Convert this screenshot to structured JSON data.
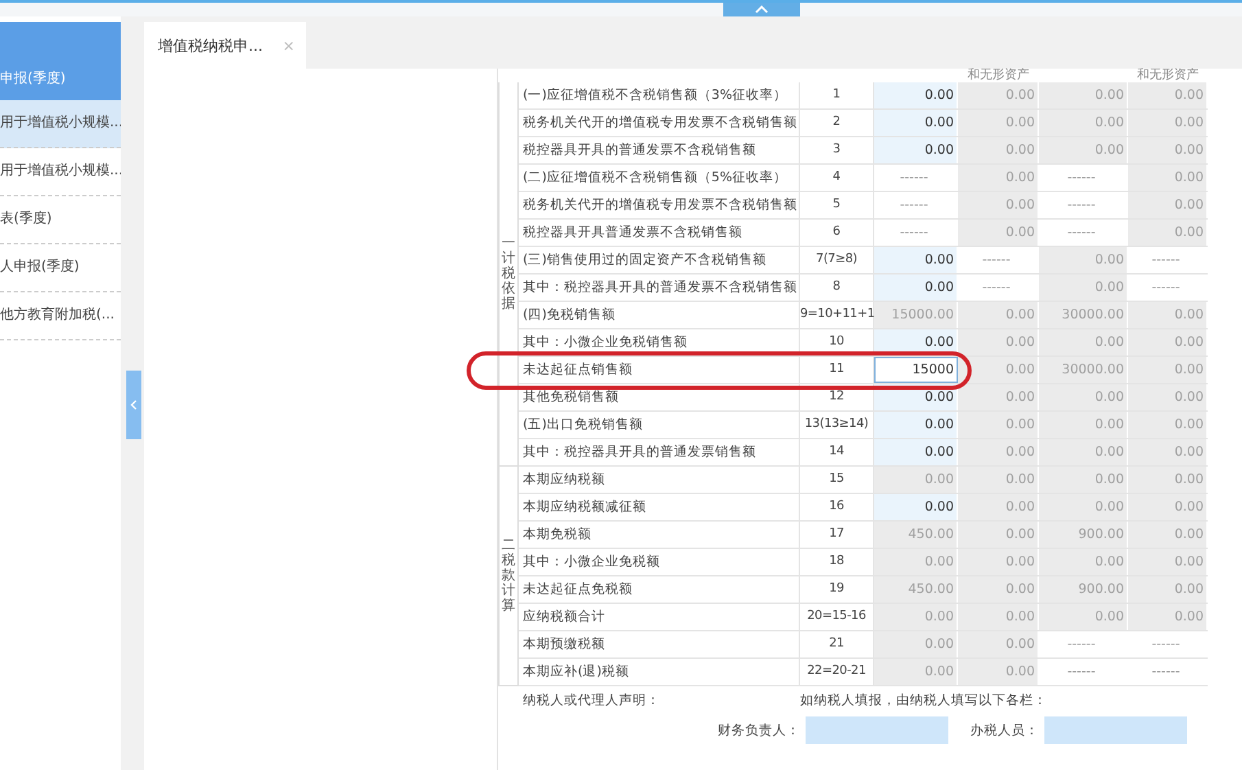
{
  "sidebar": {
    "items": [
      {
        "label": "申报(季度)",
        "kind": "header"
      },
      {
        "label": "用于增值税小规模...",
        "kind": "item",
        "selected": true
      },
      {
        "label": "用于增值税小规模...",
        "kind": "item",
        "selected": false
      },
      {
        "label": "表(季度)",
        "kind": "item",
        "selected": false
      },
      {
        "label": "人申报(季度)",
        "kind": "item",
        "selected": false
      },
      {
        "label": "他方教育附加税(...",
        "kind": "item",
        "selected": false
      }
    ]
  },
  "tabs": [
    {
      "label": "增值税纳税申...",
      "close": "×",
      "selected": true
    }
  ],
  "table": {
    "column_headers": {
      "column_2": "和无形资产",
      "column_4": "和无形资产"
    },
    "sections": [
      {
        "label": "一计税依据",
        "rows": [
          {
            "label": "(一)应征增值税不含税销售额（3%征收率）",
            "line": "1",
            "highlighted": false,
            "cells": [
              {
                "value": "0.00",
                "kind": "input"
              },
              {
                "value": "0.00",
                "kind": "calc"
              },
              {
                "value": "0.00",
                "kind": "calc"
              },
              {
                "value": "0.00",
                "kind": "calc"
              }
            ]
          },
          {
            "label": "税务机关代开的增值税专用发票不含税销售额",
            "line": "2",
            "highlighted": false,
            "cells": [
              {
                "value": "0.00",
                "kind": "input"
              },
              {
                "value": "0.00",
                "kind": "calc"
              },
              {
                "value": "0.00",
                "kind": "calc"
              },
              {
                "value": "0.00",
                "kind": "calc"
              }
            ]
          },
          {
            "label": "税控器具开具的普通发票不含税销售额",
            "line": "3",
            "highlighted": false,
            "cells": [
              {
                "value": "0.00",
                "kind": "input"
              },
              {
                "value": "0.00",
                "kind": "calc"
              },
              {
                "value": "0.00",
                "kind": "calc"
              },
              {
                "value": "0.00",
                "kind": "calc"
              }
            ]
          },
          {
            "label": "(二)应征增值税不含税销售额（5%征收率）",
            "line": "4",
            "highlighted": false,
            "cells": [
              {
                "value": "------",
                "kind": "blank"
              },
              {
                "value": "0.00",
                "kind": "calc"
              },
              {
                "value": "------",
                "kind": "blank"
              },
              {
                "value": "0.00",
                "kind": "calc"
              }
            ]
          },
          {
            "label": "税务机关代开的增值税专用发票不含税销售额",
            "line": "5",
            "highlighted": false,
            "cells": [
              {
                "value": "------",
                "kind": "blank"
              },
              {
                "value": "0.00",
                "kind": "calc"
              },
              {
                "value": "------",
                "kind": "blank"
              },
              {
                "value": "0.00",
                "kind": "calc"
              }
            ]
          },
          {
            "label": "税控器具开具普通发票不含税销售额",
            "line": "6",
            "highlighted": false,
            "cells": [
              {
                "value": "------",
                "kind": "blank"
              },
              {
                "value": "0.00",
                "kind": "calc"
              },
              {
                "value": "------",
                "kind": "blank"
              },
              {
                "value": "0.00",
                "kind": "calc"
              }
            ]
          },
          {
            "label": "(三)销售使用过的固定资产不含税销售额",
            "line": "7(7≥8)",
            "highlighted": false,
            "cells": [
              {
                "value": "0.00",
                "kind": "input"
              },
              {
                "value": "------",
                "kind": "blank"
              },
              {
                "value": "0.00",
                "kind": "calc"
              },
              {
                "value": "------",
                "kind": "blank"
              }
            ]
          },
          {
            "label": "其中：税控器具开具的普通发票不含税销售额",
            "line": "8",
            "highlighted": false,
            "cells": [
              {
                "value": "0.00",
                "kind": "input"
              },
              {
                "value": "------",
                "kind": "blank"
              },
              {
                "value": "0.00",
                "kind": "calc"
              },
              {
                "value": "------",
                "kind": "blank"
              }
            ]
          },
          {
            "label": "(四)免税销售额",
            "line": "9=10+11+1",
            "highlighted": false,
            "cells": [
              {
                "value": "15000.00",
                "kind": "calc"
              },
              {
                "value": "0.00",
                "kind": "calc"
              },
              {
                "value": "30000.00",
                "kind": "calc"
              },
              {
                "value": "0.00",
                "kind": "calc"
              }
            ]
          },
          {
            "label": "其中：小微企业免税销售额",
            "line": "10",
            "highlighted": false,
            "cells": [
              {
                "value": "0.00",
                "kind": "input"
              },
              {
                "value": "0.00",
                "kind": "calc"
              },
              {
                "value": "0.00",
                "kind": "calc"
              },
              {
                "value": "0.00",
                "kind": "calc"
              }
            ]
          },
          {
            "label": "未达起征点销售额",
            "line": "11",
            "highlighted": true,
            "cells": [
              {
                "value": "15000",
                "kind": "active"
              },
              {
                "value": "0.00",
                "kind": "calc"
              },
              {
                "value": "30000.00",
                "kind": "calc"
              },
              {
                "value": "0.00",
                "kind": "calc"
              }
            ]
          },
          {
            "label": "其他免税销售额",
            "line": "12",
            "highlighted": false,
            "cells": [
              {
                "value": "0.00",
                "kind": "input"
              },
              {
                "value": "0.00",
                "kind": "calc"
              },
              {
                "value": "0.00",
                "kind": "calc"
              },
              {
                "value": "0.00",
                "kind": "calc"
              }
            ]
          },
          {
            "label": "(五)出口免税销售额",
            "line": "13(13≥14)",
            "highlighted": false,
            "cells": [
              {
                "value": "0.00",
                "kind": "input"
              },
              {
                "value": "0.00",
                "kind": "calc"
              },
              {
                "value": "0.00",
                "kind": "calc"
              },
              {
                "value": "0.00",
                "kind": "calc"
              }
            ]
          },
          {
            "label": "其中：税控器具开具的普通发票销售额",
            "line": "14",
            "highlighted": false,
            "cells": [
              {
                "value": "0.00",
                "kind": "input"
              },
              {
                "value": "0.00",
                "kind": "calc"
              },
              {
                "value": "0.00",
                "kind": "calc"
              },
              {
                "value": "0.00",
                "kind": "calc"
              }
            ]
          }
        ]
      },
      {
        "label": "二税款计算",
        "rows": [
          {
            "label": "本期应纳税额",
            "line": "15",
            "highlighted": false,
            "cells": [
              {
                "value": "0.00",
                "kind": "calc"
              },
              {
                "value": "0.00",
                "kind": "calc"
              },
              {
                "value": "0.00",
                "kind": "calc"
              },
              {
                "value": "0.00",
                "kind": "calc"
              }
            ]
          },
          {
            "label": "本期应纳税额减征额",
            "line": "16",
            "highlighted": false,
            "cells": [
              {
                "value": "0.00",
                "kind": "input"
              },
              {
                "value": "0.00",
                "kind": "calc"
              },
              {
                "value": "0.00",
                "kind": "calc"
              },
              {
                "value": "0.00",
                "kind": "calc"
              }
            ]
          },
          {
            "label": "本期免税额",
            "line": "17",
            "highlighted": false,
            "cells": [
              {
                "value": "450.00",
                "kind": "calc"
              },
              {
                "value": "0.00",
                "kind": "calc"
              },
              {
                "value": "900.00",
                "kind": "calc"
              },
              {
                "value": "0.00",
                "kind": "calc"
              }
            ]
          },
          {
            "label": "其中：小微企业免税额",
            "line": "18",
            "highlighted": false,
            "cells": [
              {
                "value": "0.00",
                "kind": "calc"
              },
              {
                "value": "0.00",
                "kind": "calc"
              },
              {
                "value": "0.00",
                "kind": "calc"
              },
              {
                "value": "0.00",
                "kind": "calc"
              }
            ]
          },
          {
            "label": "未达起征点免税额",
            "line": "19",
            "highlighted": false,
            "cells": [
              {
                "value": "450.00",
                "kind": "calc"
              },
              {
                "value": "0.00",
                "kind": "calc"
              },
              {
                "value": "900.00",
                "kind": "calc"
              },
              {
                "value": "0.00",
                "kind": "calc"
              }
            ]
          },
          {
            "label": "应纳税额合计",
            "line": "20=15-16",
            "highlighted": false,
            "cells": [
              {
                "value": "0.00",
                "kind": "calc"
              },
              {
                "value": "0.00",
                "kind": "calc"
              },
              {
                "value": "0.00",
                "kind": "calc"
              },
              {
                "value": "0.00",
                "kind": "calc"
              }
            ]
          },
          {
            "label": "本期预缴税额",
            "line": "21",
            "highlighted": false,
            "cells": [
              {
                "value": "0.00",
                "kind": "calc"
              },
              {
                "value": "0.00",
                "kind": "calc"
              },
              {
                "value": "------",
                "kind": "blank"
              },
              {
                "value": "------",
                "kind": "blank"
              }
            ]
          },
          {
            "label": "本期应补(退)税额",
            "line": "22=20-21",
            "highlighted": false,
            "cells": [
              {
                "value": "0.00",
                "kind": "calc"
              },
              {
                "value": "0.00",
                "kind": "calc"
              },
              {
                "value": "------",
                "kind": "blank"
              },
              {
                "value": "------",
                "kind": "blank"
              }
            ]
          }
        ]
      }
    ]
  },
  "declaration": {
    "label": "纳税人或代理人声明：",
    "note": "如纳税人填报，由纳税人填写以下各栏：",
    "fields": [
      {
        "label": "财务负责人："
      },
      {
        "label": "办税人员："
      }
    ]
  }
}
